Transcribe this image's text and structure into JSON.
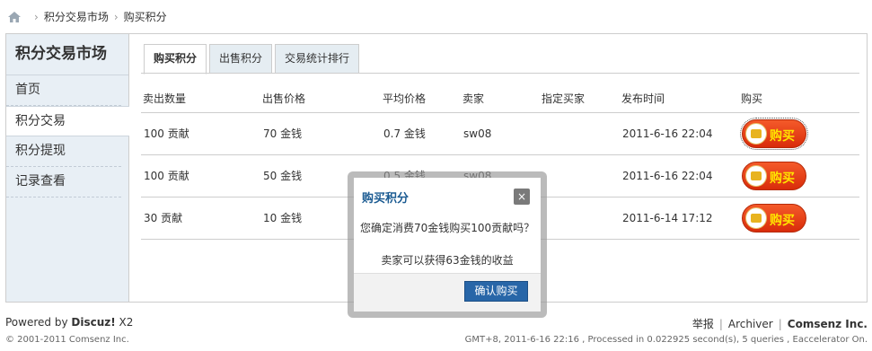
{
  "breadcrumb": {
    "items": [
      "积分交易市场",
      "购买积分"
    ],
    "separator": "›"
  },
  "sidebar": {
    "title": "积分交易市场",
    "items": [
      {
        "label": "首页",
        "active": false
      },
      {
        "label": "积分交易",
        "active": true
      },
      {
        "label": "积分提现",
        "active": false
      },
      {
        "label": "记录查看",
        "active": false
      }
    ]
  },
  "tabs": [
    {
      "label": "购买积分",
      "active": true
    },
    {
      "label": "出售积分",
      "active": false
    },
    {
      "label": "交易统计排行",
      "active": false
    }
  ],
  "table": {
    "headers": [
      "卖出数量",
      "出售价格",
      "平均价格",
      "卖家",
      "指定买家",
      "发布时间",
      "购买"
    ],
    "rows": [
      {
        "qty": "100 贡献",
        "price": "70 金钱",
        "avg": "0.7 金钱",
        "seller": "sw08",
        "buyer": "",
        "time": "2011-6-16 22:04",
        "buy": "购买"
      },
      {
        "qty": "100 贡献",
        "price": "50 金钱",
        "avg": "0.5 金钱",
        "seller": "sw08",
        "buyer": "",
        "time": "2011-6-16 22:04",
        "buy": "购买"
      },
      {
        "qty": "30 贡献",
        "price": "10 金钱",
        "avg": "",
        "seller": "",
        "buyer": "",
        "time": "2011-6-14 17:12",
        "buy": "购买"
      }
    ]
  },
  "dialog": {
    "title": "购买积分",
    "close": "×",
    "message": "您确定消费70金钱购买100贡献吗？",
    "note": "卖家可以获得63金钱的收益",
    "confirm": "确认购买"
  },
  "footer": {
    "powered_prefix": "Powered by ",
    "powered_brand": "Discuz!",
    "powered_version": " X2",
    "copyright": "© 2001-2011 Comsenz Inc.",
    "links": [
      "举报",
      "Archiver",
      "Comsenz Inc."
    ],
    "gmt": "GMT+8, 2011-6-16 22:16 , Processed in 0.022925 second(s), 5 queries , Eaccelerator On."
  },
  "colors": {
    "accent": "#1b5b92",
    "sidebar_bg": "#e8eff5",
    "buy_button": "#e0360f",
    "confirm_button": "#2866a8"
  },
  "icons": {
    "home": "home-icon",
    "close": "close-icon",
    "coin": "coin-icon"
  }
}
